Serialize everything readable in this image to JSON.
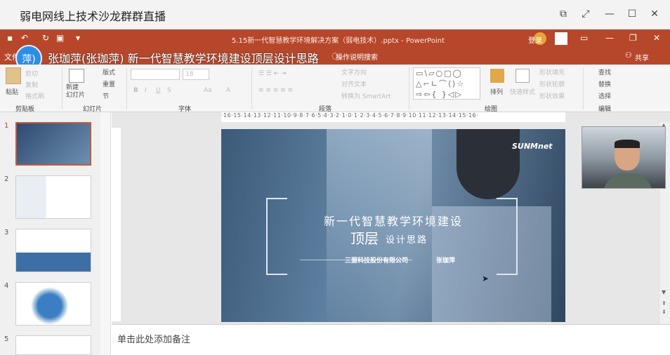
{
  "outer": {
    "title": "弱电网线上技术沙龙群群直播"
  },
  "ppt": {
    "doc_title": "5.15新一代智慧教学环境解决方案（弱电技术）.pptx - PowerPoint",
    "login": "登录",
    "share": "共享",
    "tell_me": "操作说明搜索",
    "file_tab": "文件"
  },
  "speaker": {
    "avatar_text": "萍)",
    "overlay_line": "张珈萍(张珈萍) 新一代智慧教学环境建设顶层设计思路"
  },
  "ribbon": {
    "paste": "粘贴",
    "cut": "剪切",
    "copy": "复制",
    "format_painter": "格式刷",
    "new_slide": "新建\n幻灯片",
    "layout": "版式",
    "reset": "重置",
    "section": "节",
    "font_size": "18",
    "text_direction": "文字方向",
    "align_text": "对齐文本",
    "smartart": "转换为 SmartArt",
    "arrange": "排列",
    "quick_styles": "快速样式",
    "shape_fill": "形状填充",
    "shape_outline": "形状轮廓",
    "shape_effects": "形状效果",
    "find": "查找",
    "replace": "替换",
    "select": "选择",
    "groups": {
      "clipboard": "剪贴板",
      "slides": "幻灯片",
      "font": "字体",
      "paragraph": "段落",
      "drawing": "绘图",
      "editing": "编辑"
    }
  },
  "ruler": {
    "h": "·16·15·14·13·12·11·10·9·8·7·6·5·4·3·2·1·0·1·2·3·4·5·6·7·8·9·10·11·12·13·14·15·16·"
  },
  "thumbnails": [
    {
      "num": "1"
    },
    {
      "num": "2"
    },
    {
      "num": "3"
    },
    {
      "num": "4"
    },
    {
      "num": "5"
    }
  ],
  "slide": {
    "logo": "SUNMnet",
    "title": "新一代智慧教学环境建设",
    "subtitle_big": "顶层",
    "subtitle_rest": "设计思路",
    "company": "三盟科技股份有限公司",
    "presenter": "张珈萍"
  },
  "notes": {
    "placeholder": "单击此处添加备注"
  },
  "colors": {
    "ppt_accent": "#b7472a",
    "avatar": "#2d8ee8"
  }
}
